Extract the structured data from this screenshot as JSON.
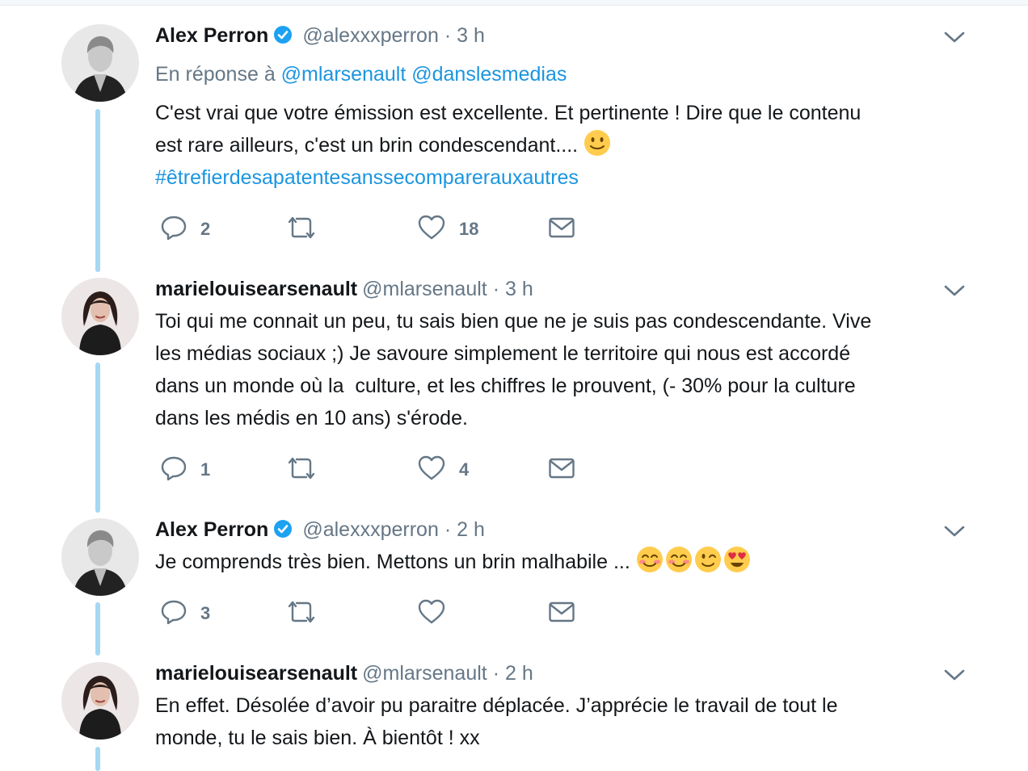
{
  "colors": {
    "link": "#1b95e0",
    "secondary": "#657786",
    "thread_line": "#a5d8f3",
    "verified": "#1da1f2"
  },
  "tweets": [
    {
      "name": "Alex Perron",
      "verified": true,
      "handle": "@alexxxperron",
      "dot": "·",
      "time": "3 h",
      "reply_prefix": "En réponse à",
      "reply_mentions": [
        "@mlarsenault",
        "@danslesmedias"
      ],
      "lines": [
        "C'est vrai que votre émission est excellente. Et pertinente ! Dire que le contenu",
        "est rare ailleurs, c'est un brin condescendant...."
      ],
      "emojis": [
        "slightly-smiling-face"
      ],
      "hashtag": "#êtrefierdesapatentesanssecompareraux autres",
      "replies": "2",
      "retweets": "",
      "likes": "18"
    },
    {
      "name": "marielouisearsenault",
      "verified": false,
      "handle": "@mlarsenault",
      "dot": "·",
      "time": "3 h",
      "lines": [
        "Toi qui me connait un peu, tu sais bien que ne je suis pas condescendante. Vive",
        "les médias sociaux ;) Je savoure simplement le territoire qui nous est accordé",
        "dans un monde où la  culture, et les chiffres le prouvent, (- 30% pour la culture",
        "dans les médis en 10 ans) s'érode."
      ],
      "replies": "1",
      "retweets": "",
      "likes": "4"
    },
    {
      "name": "Alex Perron",
      "verified": true,
      "handle": "@alexxxperron",
      "dot": "·",
      "time": "2 h",
      "lines": [
        "Je comprends très bien. Mettons un brin malhabile ..."
      ],
      "emojis": [
        "smiling-face-with-smiling-eyes",
        "smiling-face-with-smiling-eyes",
        "winking-face",
        "heart-eyes-face"
      ],
      "replies": "3",
      "retweets": "",
      "likes": ""
    },
    {
      "name": "marielouisearsenault",
      "verified": false,
      "handle": "@mlarsenault",
      "dot": "·",
      "time": "2 h",
      "lines": [
        "En effet. Désolée d’avoir pu paraitre déplacée. J’apprécie le travail de tout le",
        "monde, tu le sais bien. À bientôt ! xx"
      ]
    }
  ]
}
